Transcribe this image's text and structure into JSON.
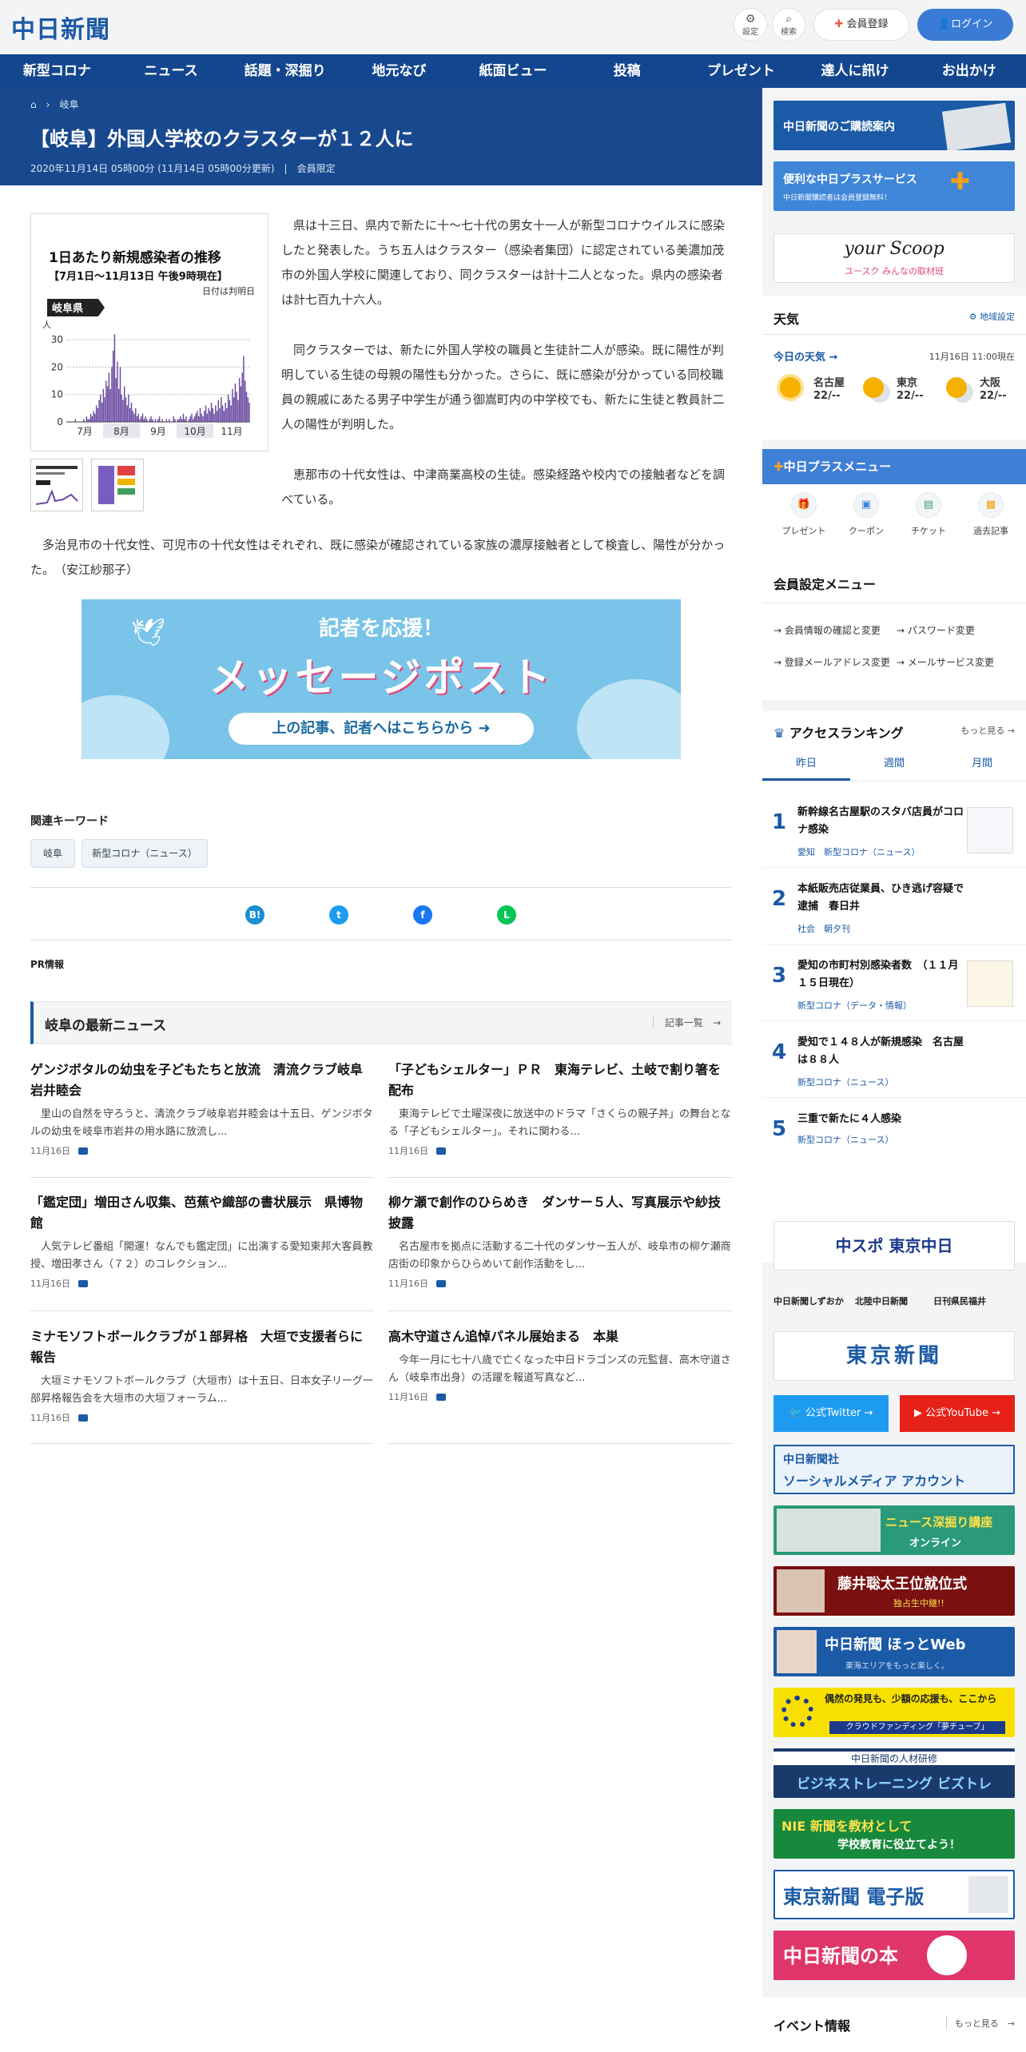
{
  "header": {
    "logo": "中日新聞",
    "settings_label": "設定",
    "search_label": "検索",
    "register_label": "会員登録",
    "login_label": "ログイン"
  },
  "nav": [
    "新型コロナ",
    "ニュース",
    "話題・深掘り",
    "地元なび",
    "紙面ビュー",
    "投稿",
    "プレゼント",
    "達人に訊け",
    "お出かけ"
  ],
  "breadcrumb": {
    "current": "岐阜"
  },
  "article": {
    "title": "【岐阜】外国人学校のクラスターが１２人に",
    "meta": "2020年11月14日 05時00分 (11月14日 05時00分更新)",
    "member": "会員限定",
    "paragraphs": [
      "県は十三日、県内で新たに十〜七十代の男女十一人が新型コロナウイルスに感染したと発表した。うち五人はクラスター（感染者集団）に認定されている美濃加茂市の外国人学校に関連しており、同クラスターは計十二人となった。県内の感染者は計七百九十六人。",
      "同クラスターでは、新たに外国人学校の職員と生徒計二人が感染。既に陽性が判明している生徒の母親の陽性も分かった。さらに、既に感染が分かっている同校職員の親戚にあたる男子中学生が通う御嵩町内の中学校でも、新たに生徒と教員計二人の陽性が判明した。",
      "恵那市の十代女性は、中津商業高校の生徒。感染経路や校内での接触者などを調べている。",
      "多治見市の十代女性、可児市の十代女性はそれぞれ、既に感染が確認されている家族の濃厚接触者として検査し、陽性が分かった。　（安江紗那子）"
    ]
  },
  "chart_data": {
    "type": "bar",
    "title": "1日あたり新規感染者の推移",
    "subtitle": "【7月1日〜11月13日 午後9時現在】",
    "note": "日付は判明日",
    "region": "岐阜県",
    "ylabel": "人",
    "yticks": [
      "30",
      "20",
      "10",
      "0"
    ],
    "ylim": [
      0,
      35
    ],
    "xticks": [
      "7月",
      "8月",
      "9月",
      "10月",
      "11月"
    ],
    "values": [
      0,
      0,
      0,
      0,
      0,
      0,
      1,
      0,
      0,
      0,
      0,
      0,
      1,
      0,
      2,
      1,
      1,
      3,
      2,
      4,
      3,
      6,
      5,
      8,
      10,
      7,
      12,
      9,
      15,
      13,
      18,
      12,
      20,
      26,
      32,
      16,
      22,
      12,
      20,
      10,
      8,
      13,
      9,
      6,
      10,
      5,
      7,
      4,
      3,
      5,
      2,
      3,
      1,
      2,
      3,
      1,
      2,
      1,
      0,
      1,
      2,
      1,
      0,
      1,
      0,
      1,
      2,
      0,
      1,
      0,
      0,
      1,
      0,
      1,
      0,
      0,
      2,
      1,
      0,
      1,
      1,
      2,
      1,
      3,
      1,
      2,
      0,
      1,
      2,
      3,
      1,
      2,
      3,
      4,
      2,
      5,
      3,
      2,
      4,
      6,
      3,
      5,
      4,
      7,
      5,
      3,
      6,
      4,
      8,
      5,
      9,
      6,
      4,
      7,
      5,
      10,
      8,
      6,
      12,
      9,
      14,
      11,
      8,
      16,
      13,
      18,
      24,
      15,
      11,
      9,
      7
    ]
  },
  "banner": {
    "small": "記者を応援！",
    "big": "メッセージポスト",
    "cta": "上の記事、記者へはこちらから"
  },
  "keywords": {
    "label": "関連キーワード",
    "items": [
      "岐阜",
      "新型コロナ（ニュース）"
    ]
  },
  "share": [
    "B!",
    "t",
    "f",
    "L"
  ],
  "pr_label": "PR情報",
  "latest": {
    "title": "岐阜の最新ニュース",
    "more": "記事一覧",
    "items": [
      {
        "h": "ゲンジボタルの幼虫を子どもたちと放流　清流クラブ岐阜岩井睦会",
        "b": "里山の自然を守ろうと、清流クラブ岐阜岩井睦会は十五日、ゲンジボタルの幼虫を岐阜市岩井の用水路に放流し...",
        "d": "11月16日"
      },
      {
        "h": "「子どもシェルター」ＰＲ　東海テレビ、土岐で割り箸を配布",
        "b": "東海テレビで土曜深夜に放送中のドラマ「さくらの親子丼」の舞台となる「子どもシェルター」。それに関わる...",
        "d": "11月16日"
      },
      {
        "h": "「鑑定団」増田さん収集、芭蕉や織部の書状展示　県博物館",
        "b": "人気テレビ番組「開運！なんでも鑑定団」に出演する愛知東邦大客員教授、増田孝さん（７２）のコレクション...",
        "d": "11月16日"
      },
      {
        "h": "柳ケ瀬で創作のひらめき　ダンサー５人、写真展示や紗技披露",
        "b": "名古屋市を拠点に活動する二十代のダンサー五人が、岐阜市の柳ケ瀬商店街の印象からひらめいて創作活動をし...",
        "d": "11月16日"
      },
      {
        "h": "ミナモソフトボールクラブが１部昇格　大垣で支援者らに報告",
        "b": "大垣ミナモソフトボールクラブ（大垣市）は十五日、日本女子リーグ一部昇格報告会を大垣市の大垣フォーラム...",
        "d": "11月16日"
      },
      {
        "h": "高木守道さん追悼パネル展始まる　本巣",
        "b": "今年一月に七十八歳で亡くなった中日ドラゴンズの元監督、高木守道さん（岐阜市出身）の活躍を報道写真など...",
        "d": "11月16日"
      }
    ]
  },
  "sidebar": {
    "banners": [
      "中日新聞のご購読案内",
      "便利な中日プラスサービス",
      "中日新聞購読者は会員登録無料！",
      "your Scoop",
      "ユースク みんなの取材班"
    ],
    "weather": {
      "title": "天気",
      "area": "地域設定",
      "today": "今日の天気",
      "time": "11月16日 11:00現在",
      "cities": [
        {
          "n": "名古屋",
          "v": "22/--"
        },
        {
          "n": "東京",
          "v": "22/--"
        },
        {
          "n": "大阪",
          "v": "22/--"
        }
      ]
    },
    "plus": {
      "title": "中日プラスメニュー",
      "items": [
        "プレゼント",
        "クーポン",
        "チケット",
        "過去記事"
      ]
    },
    "member": {
      "title": "会員設定メニュー",
      "items": [
        "会員情報の確認と変更",
        "パスワード変更",
        "登録メールアドレス変更",
        "メールサービス変更"
      ]
    },
    "ranking": {
      "title": "アクセスランキング",
      "more": "もっと見る",
      "tabs": [
        "昨日",
        "週間",
        "月間"
      ],
      "items": [
        {
          "n": "1",
          "t": "新幹線名古屋駅のスタバ店員がコロナ感染",
          "c": "愛知　新型コロナ（ニュース）"
        },
        {
          "n": "2",
          "t": "本紙販売店従業員、ひき逃げ容疑で逮捕　春日井",
          "c": "社会　朝夕刊"
        },
        {
          "n": "3",
          "t": "愛知の市町村別感染者数　（１１月１５日現在）",
          "c": "新型コロナ（データ・情報）"
        },
        {
          "n": "4",
          "t": "愛知で１４８人が新規感染　名古屋は８８人",
          "c": "新型コロナ（ニュース）"
        },
        {
          "n": "5",
          "t": "三重で新たに４人感染",
          "c": "新型コロナ（ニュース）"
        }
      ]
    },
    "chuspo": "中スポ 東京中日",
    "sister": [
      "中日新聞しずおか",
      "北陸中日新聞",
      "日刊県民福井"
    ],
    "tokyo": "東京新聞",
    "twitter": "公式Twitter",
    "youtube": "公式YouTube",
    "social": [
      "中日新聞社",
      "ソーシャルメディア アカウント"
    ],
    "promo": [
      {
        "t": "ニュース深掘り講座",
        "s": "オンライン"
      },
      {
        "t": "藤井聡太王位就位式",
        "s": "独占生中継!!"
      },
      {
        "t": "中日新聞 ほっとWeb",
        "s": "東海エリアをもっと楽しく。"
      },
      {
        "t": "偶然の発見も、少額の応援も、ここから",
        "s": "クラウドファンディング「夢チューブ」"
      },
      {
        "t": "中日新聞の人材研修",
        "s": "ビジネストレーニング ビズトレ"
      },
      {
        "t": "NIE 新聞を教材として",
        "s": "学校教育に役立てよう！"
      },
      {
        "t": "東京新聞 電子版",
        "s": ""
      },
      {
        "t": "中日新聞の本",
        "s": ""
      }
    ],
    "events": {
      "title": "イベント情報",
      "more": "もっと見る"
    }
  },
  "colors": {
    "brand": "#1b5aa6",
    "nav": "#13468e",
    "hero": "#18488e",
    "bar": "#6a4aa0"
  }
}
